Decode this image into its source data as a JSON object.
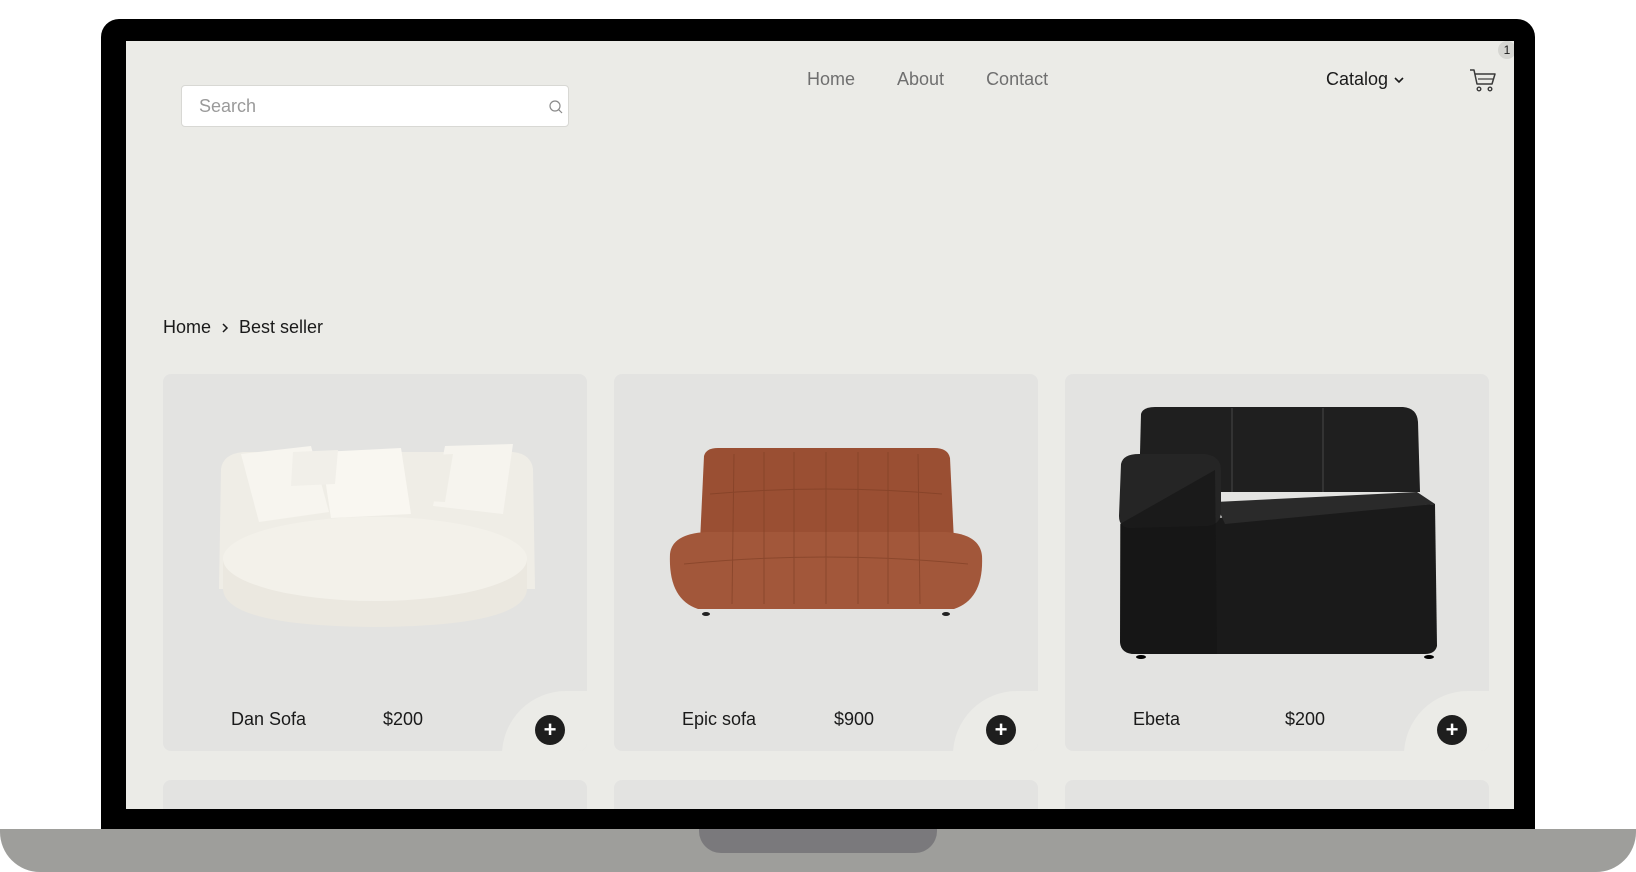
{
  "header": {
    "search": {
      "placeholder": "Search",
      "value": ""
    },
    "nav": [
      {
        "label": "Home"
      },
      {
        "label": "About"
      },
      {
        "label": "Contact"
      }
    ],
    "catalog_label": "Catalog",
    "cart_count": "1"
  },
  "breadcrumb": {
    "items": [
      "Home",
      "Best seller"
    ]
  },
  "products": [
    {
      "name": "Dan Sofa",
      "price": "$200",
      "add_label": "+"
    },
    {
      "name": "Epic sofa",
      "price": "$900",
      "add_label": "+"
    },
    {
      "name": "Ebeta",
      "price": "$200",
      "add_label": "+"
    }
  ],
  "colors": {
    "page_bg": "#ebebe7",
    "card_bg": "#e3e3e1",
    "button_bg": "#1e1e1e",
    "sofa_white": "#f1efe9",
    "sofa_rust": "#9a4f33",
    "sofa_black": "#1c1c1c"
  }
}
